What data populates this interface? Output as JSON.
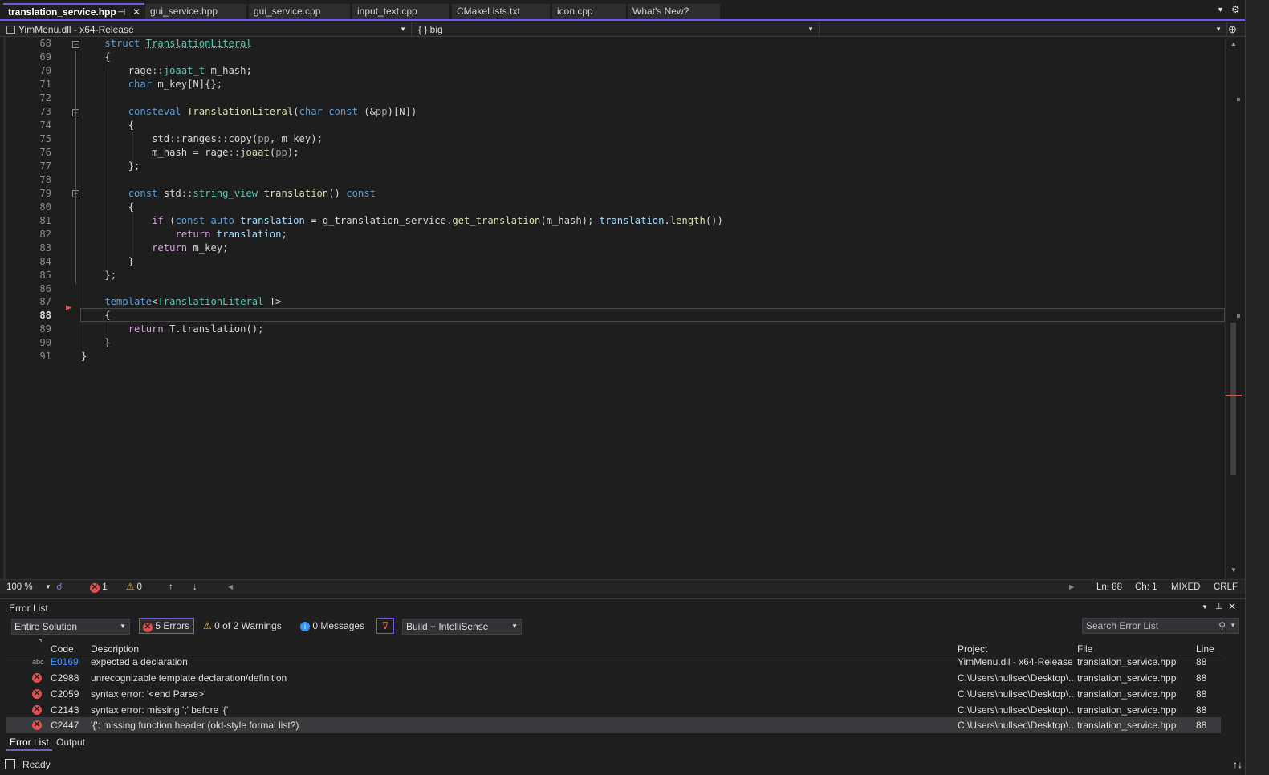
{
  "tabs": [
    {
      "label": "translation_service.hpp",
      "active": true
    },
    {
      "label": "gui_service.hpp"
    },
    {
      "label": "gui_service.cpp"
    },
    {
      "label": "input_text.cpp"
    },
    {
      "label": "CMakeLists.txt"
    },
    {
      "label": "icon.cpp"
    },
    {
      "label": "What's New?"
    }
  ],
  "navbar": {
    "project": "YimMenu.dll - x64-Release",
    "scope": "{ } big"
  },
  "code": {
    "lines": [
      {
        "n": "68"
      },
      {
        "n": "69"
      },
      {
        "n": "70"
      },
      {
        "n": "71"
      },
      {
        "n": "72"
      },
      {
        "n": "73"
      },
      {
        "n": "74"
      },
      {
        "n": "75"
      },
      {
        "n": "76"
      },
      {
        "n": "77"
      },
      {
        "n": "78"
      },
      {
        "n": "79"
      },
      {
        "n": "80"
      },
      {
        "n": "81"
      },
      {
        "n": "82"
      },
      {
        "n": "83"
      },
      {
        "n": "84"
      },
      {
        "n": "85"
      },
      {
        "n": "86"
      },
      {
        "n": "87"
      },
      {
        "n": "88"
      },
      {
        "n": "89"
      },
      {
        "n": "90"
      },
      {
        "n": "91"
      }
    ],
    "text": {
      "l68a": "struct",
      "l68b": "TranslationLiteral",
      "l69": "{",
      "l70a": "rage",
      "l70b": "::",
      "l70c": "joaat_t",
      "l70d": " m_hash;",
      "l71a": "char",
      "l71b": " m_key[N]{};",
      "l73a": "consteval",
      "l73b": " TranslationLiteral",
      "l73c": "(",
      "l73d": "char",
      "l73e": " const",
      "l73f": " (&",
      "l73g": "pp",
      "l73h": ")[N])",
      "l74": "{",
      "l75a": "std",
      "l75b": "::",
      "l75c": "ranges",
      "l75d": "::",
      "l75e": "copy",
      "l75f": "(",
      "l75g": "pp",
      "l75h": ", m_key);",
      "l76a": "m_hash = ",
      "l76b": "rage",
      "l76c": "::",
      "l76d": "joaat",
      "l76e": "(",
      "l76f": "pp",
      "l76g": ");",
      "l77": "};",
      "l79a": "const",
      "l79b": " std",
      "l79c": "::",
      "l79d": "string_view",
      "l79e": " translation",
      "l79f": "() ",
      "l79g": "const",
      "l80": "{",
      "l81a": "if",
      "l81b": " (",
      "l81c": "const",
      "l81d": " auto",
      "l81e": " translation",
      "l81f": " = g_translation_service.",
      "l81g": "get_translation",
      "l81h": "(m_hash); ",
      "l81i": "translation",
      "l81j": ".",
      "l81k": "length",
      "l81l": "())",
      "l82a": "return",
      "l82b": " translation",
      "l82c": ";",
      "l83a": "return",
      "l83b": " m_key;",
      "l84": "}",
      "l85": "};",
      "l87a": "template",
      "l87b": "<",
      "l87c": "TranslationLiteral",
      "l87d": " T>",
      "l88": "{",
      "l89a": "return",
      "l89b": " T.translation();",
      "l90": "}",
      "l91": "}"
    }
  },
  "editor_status": {
    "zoom": "100 %",
    "errors": "1",
    "warnings": "0",
    "line": "Ln: 88",
    "char": "Ch: 1",
    "tabs_mode": "MIXED",
    "line_endings": "CRLF"
  },
  "error_list": {
    "title": "Error List",
    "scope": "Entire Solution",
    "errors_btn": "5 Errors",
    "warnings_btn": "0 of 2 Warnings",
    "messages_btn": "0 Messages",
    "build_filter": "Build + IntelliSense",
    "search_placeholder": "Search Error List",
    "columns": {
      "code": "Code",
      "description": "Description",
      "project": "Project",
      "file": "File",
      "line": "Line"
    },
    "rows": [
      {
        "code": "E0169",
        "description": "expected a declaration",
        "project": "YimMenu.dll - x64-Release",
        "file": "translation_service.hpp",
        "line": "88",
        "icon": "abc"
      },
      {
        "code": "C2988",
        "description": "unrecognizable template declaration/definition",
        "project": "C:\\Users\\nullsec\\Desktop\\...",
        "file": "translation_service.hpp",
        "line": "88",
        "icon": "error"
      },
      {
        "code": "C2059",
        "description": "syntax error: '<end Parse>'",
        "project": "C:\\Users\\nullsec\\Desktop\\...",
        "file": "translation_service.hpp",
        "line": "88",
        "icon": "error"
      },
      {
        "code": "C2143",
        "description": "syntax error: missing ';' before '{'",
        "project": "C:\\Users\\nullsec\\Desktop\\...",
        "file": "translation_service.hpp",
        "line": "88",
        "icon": "error"
      },
      {
        "code": "C2447",
        "description": "'{': missing function header (old-style formal list?)",
        "project": "C:\\Users\\nullsec\\Desktop\\...",
        "file": "translation_service.hpp",
        "line": "88",
        "icon": "error"
      }
    ]
  },
  "bottom_tabs": [
    "Error List",
    "Output"
  ],
  "status": {
    "text": "Ready"
  }
}
